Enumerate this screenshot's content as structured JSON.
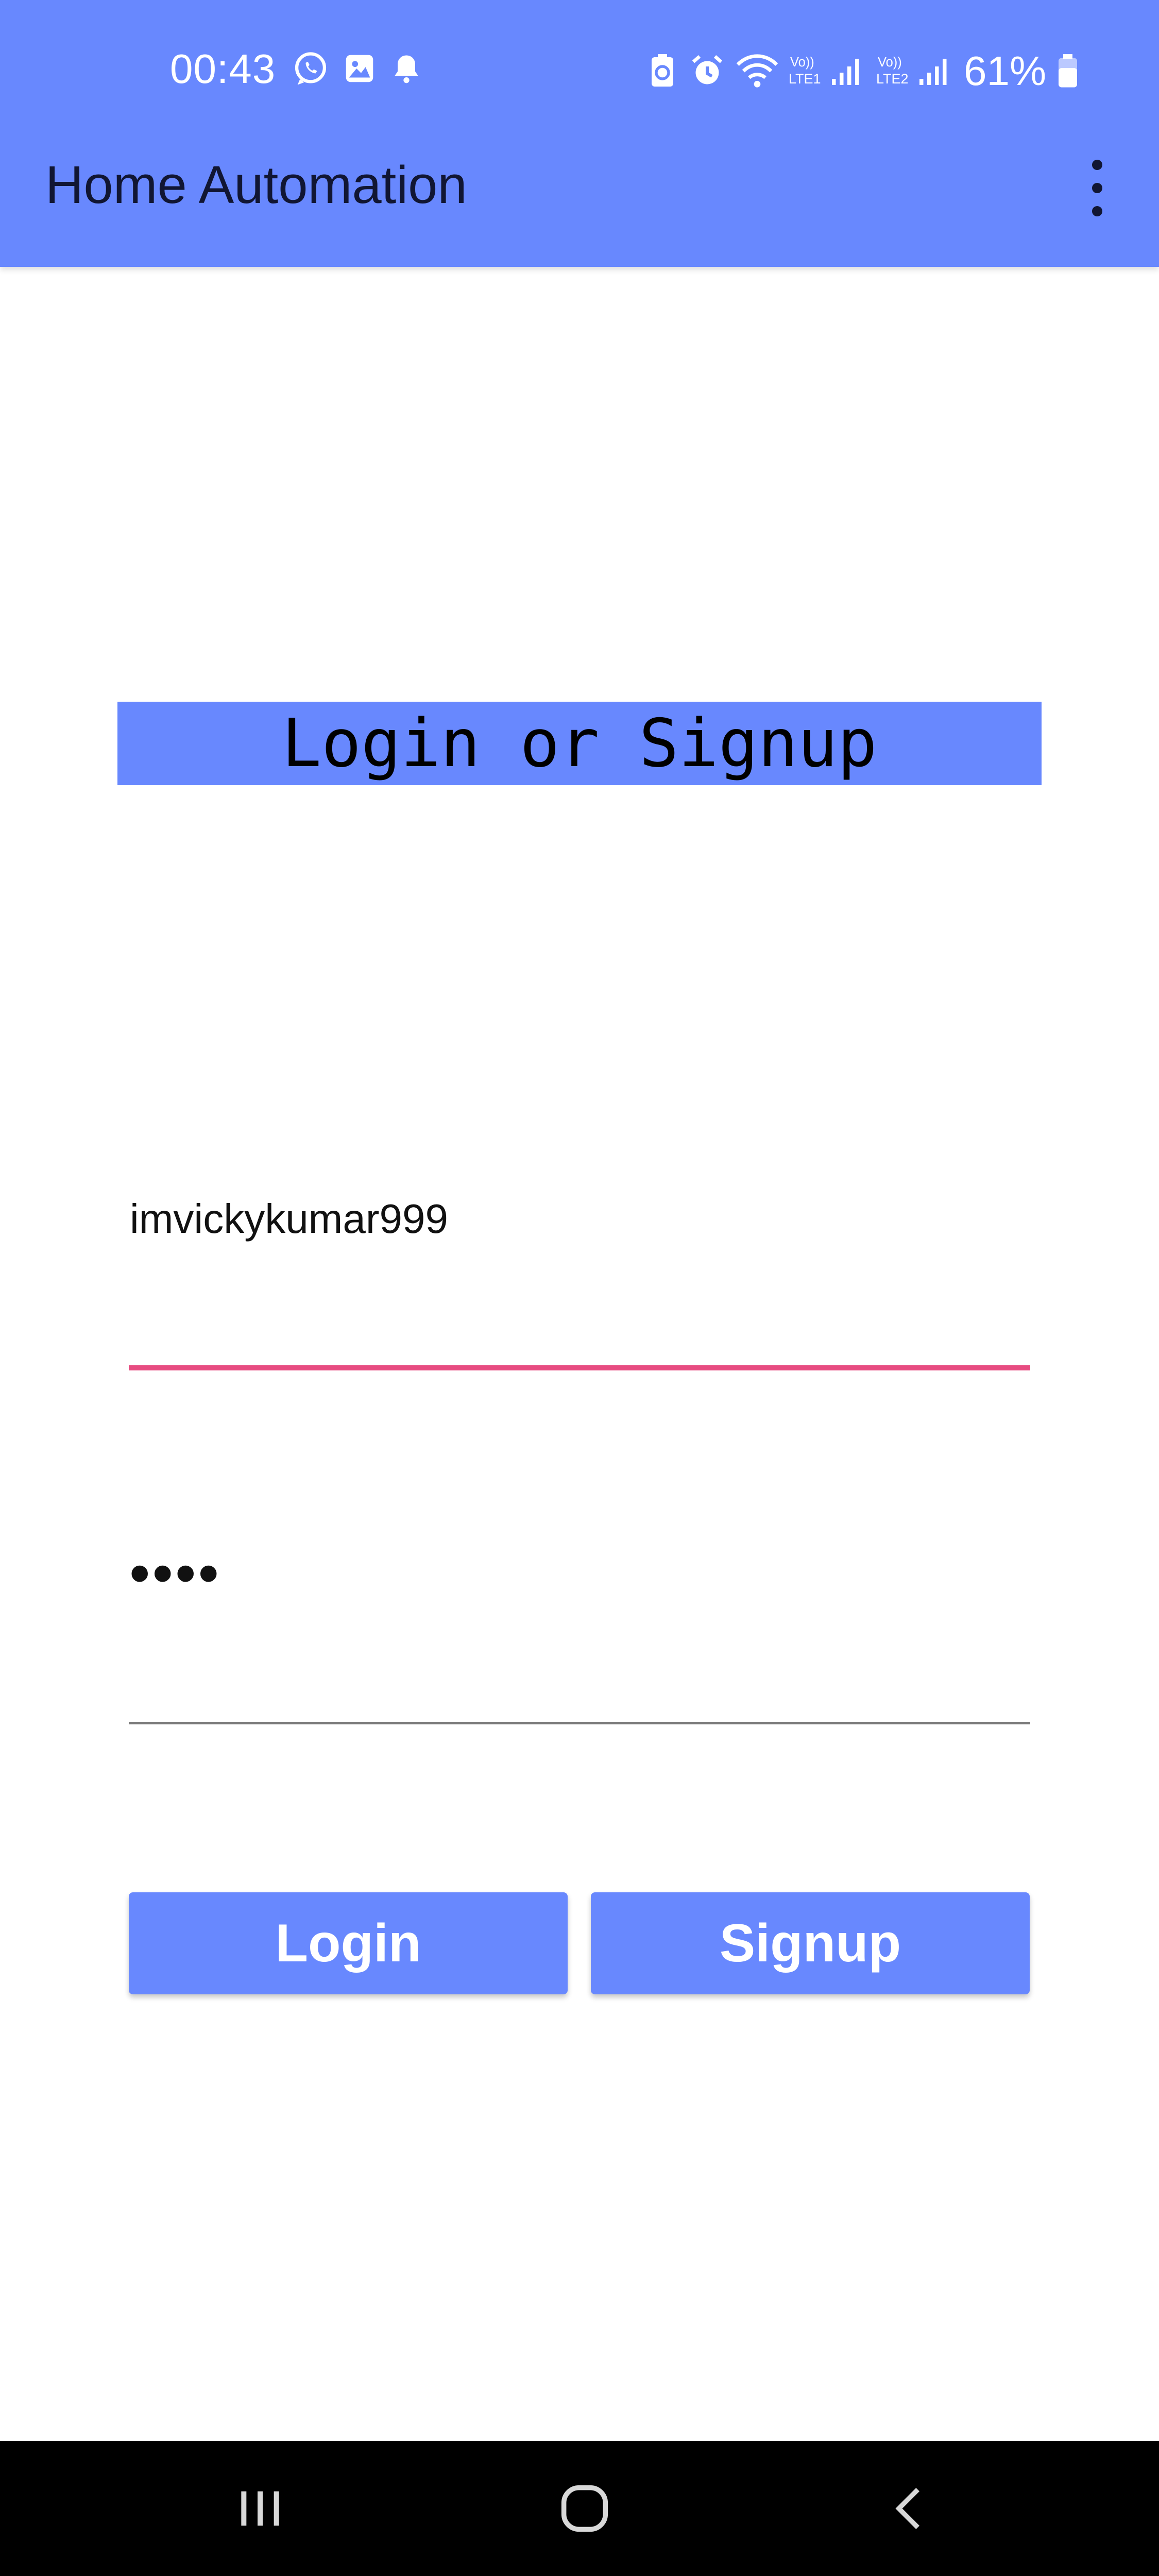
{
  "status_bar": {
    "time": "00:43",
    "battery_percent": "61%",
    "left_icons": [
      "whatsapp-icon",
      "gallery-icon",
      "notification-bell-icon"
    ],
    "right_icons": [
      "battery-saver-icon",
      "alarm-icon",
      "wifi-icon",
      "volte-lte1-signal-icon",
      "volte-lte2-signal-icon",
      "battery-icon"
    ],
    "sim1_label": "LTE1",
    "sim2_label": "LTE2",
    "volte_label": "Vo))"
  },
  "app_bar": {
    "title": "Home Automation",
    "menu_icon": "more-vert-icon"
  },
  "main": {
    "heading": "Login or Signup",
    "username_value": "imvickykumar999",
    "password_value": "••••",
    "login_label": "Login",
    "signup_label": "Signup"
  },
  "nav_bar": {
    "icons": [
      "recents-icon",
      "home-icon",
      "back-icon"
    ]
  },
  "colors": {
    "primary": "#6888fe",
    "focused_underline": "#e74c81",
    "unfocused_underline": "#7a7a7a",
    "nav_background": "#000000"
  }
}
